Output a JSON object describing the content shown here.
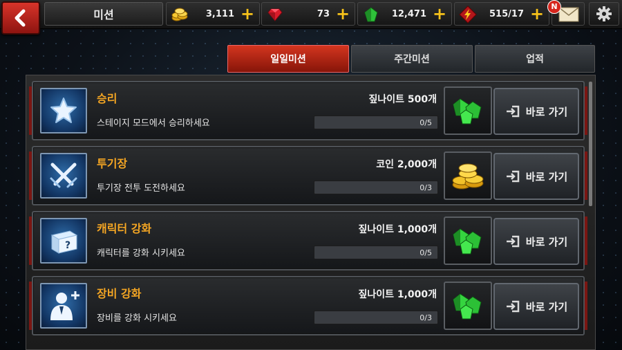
{
  "header": {
    "title": "미션",
    "gold": "3,111",
    "ruby": "73",
    "gem": "12,471",
    "energy": "515/17",
    "mail_badge": "N"
  },
  "tabs": [
    {
      "label": "일일미션",
      "active": true
    },
    {
      "label": "주간미션",
      "active": false
    },
    {
      "label": "업적",
      "active": false
    }
  ],
  "missions": [
    {
      "title": "승리",
      "desc": "스테이지 모드에서 승리하세요",
      "reward": "짚나이트 500개",
      "progress": "0/5",
      "progress_fraction": 0,
      "reward_icon": "green-gems-icon",
      "go_label": "바로 가기",
      "icon": "star-icon"
    },
    {
      "title": "투기장",
      "desc": "투기장 전투 도전하세요",
      "reward": "코인 2,000개",
      "progress": "0/3",
      "progress_fraction": 0,
      "reward_icon": "gold-coins-icon",
      "go_label": "바로 가기",
      "icon": "crossed-swords-icon"
    },
    {
      "title": "캐릭터 강화",
      "desc": "캐릭터를 강화 시키세요",
      "reward": "짚나이트 1,000개",
      "progress": "0/5",
      "progress_fraction": 0,
      "reward_icon": "green-gems-icon",
      "go_label": "바로 가기",
      "icon": "mystery-box-icon"
    },
    {
      "title": "장비 강화",
      "desc": "장비를 강화 시키세요",
      "reward": "짚나이트 1,000개",
      "progress": "0/3",
      "progress_fraction": 0,
      "reward_icon": "green-gems-icon",
      "go_label": "바로 가기",
      "icon": "character-upgrade-icon"
    }
  ],
  "colors": {
    "accent_red": "#c62a1c",
    "title_orange": "#f5a623",
    "gold": "#f7c21a"
  }
}
